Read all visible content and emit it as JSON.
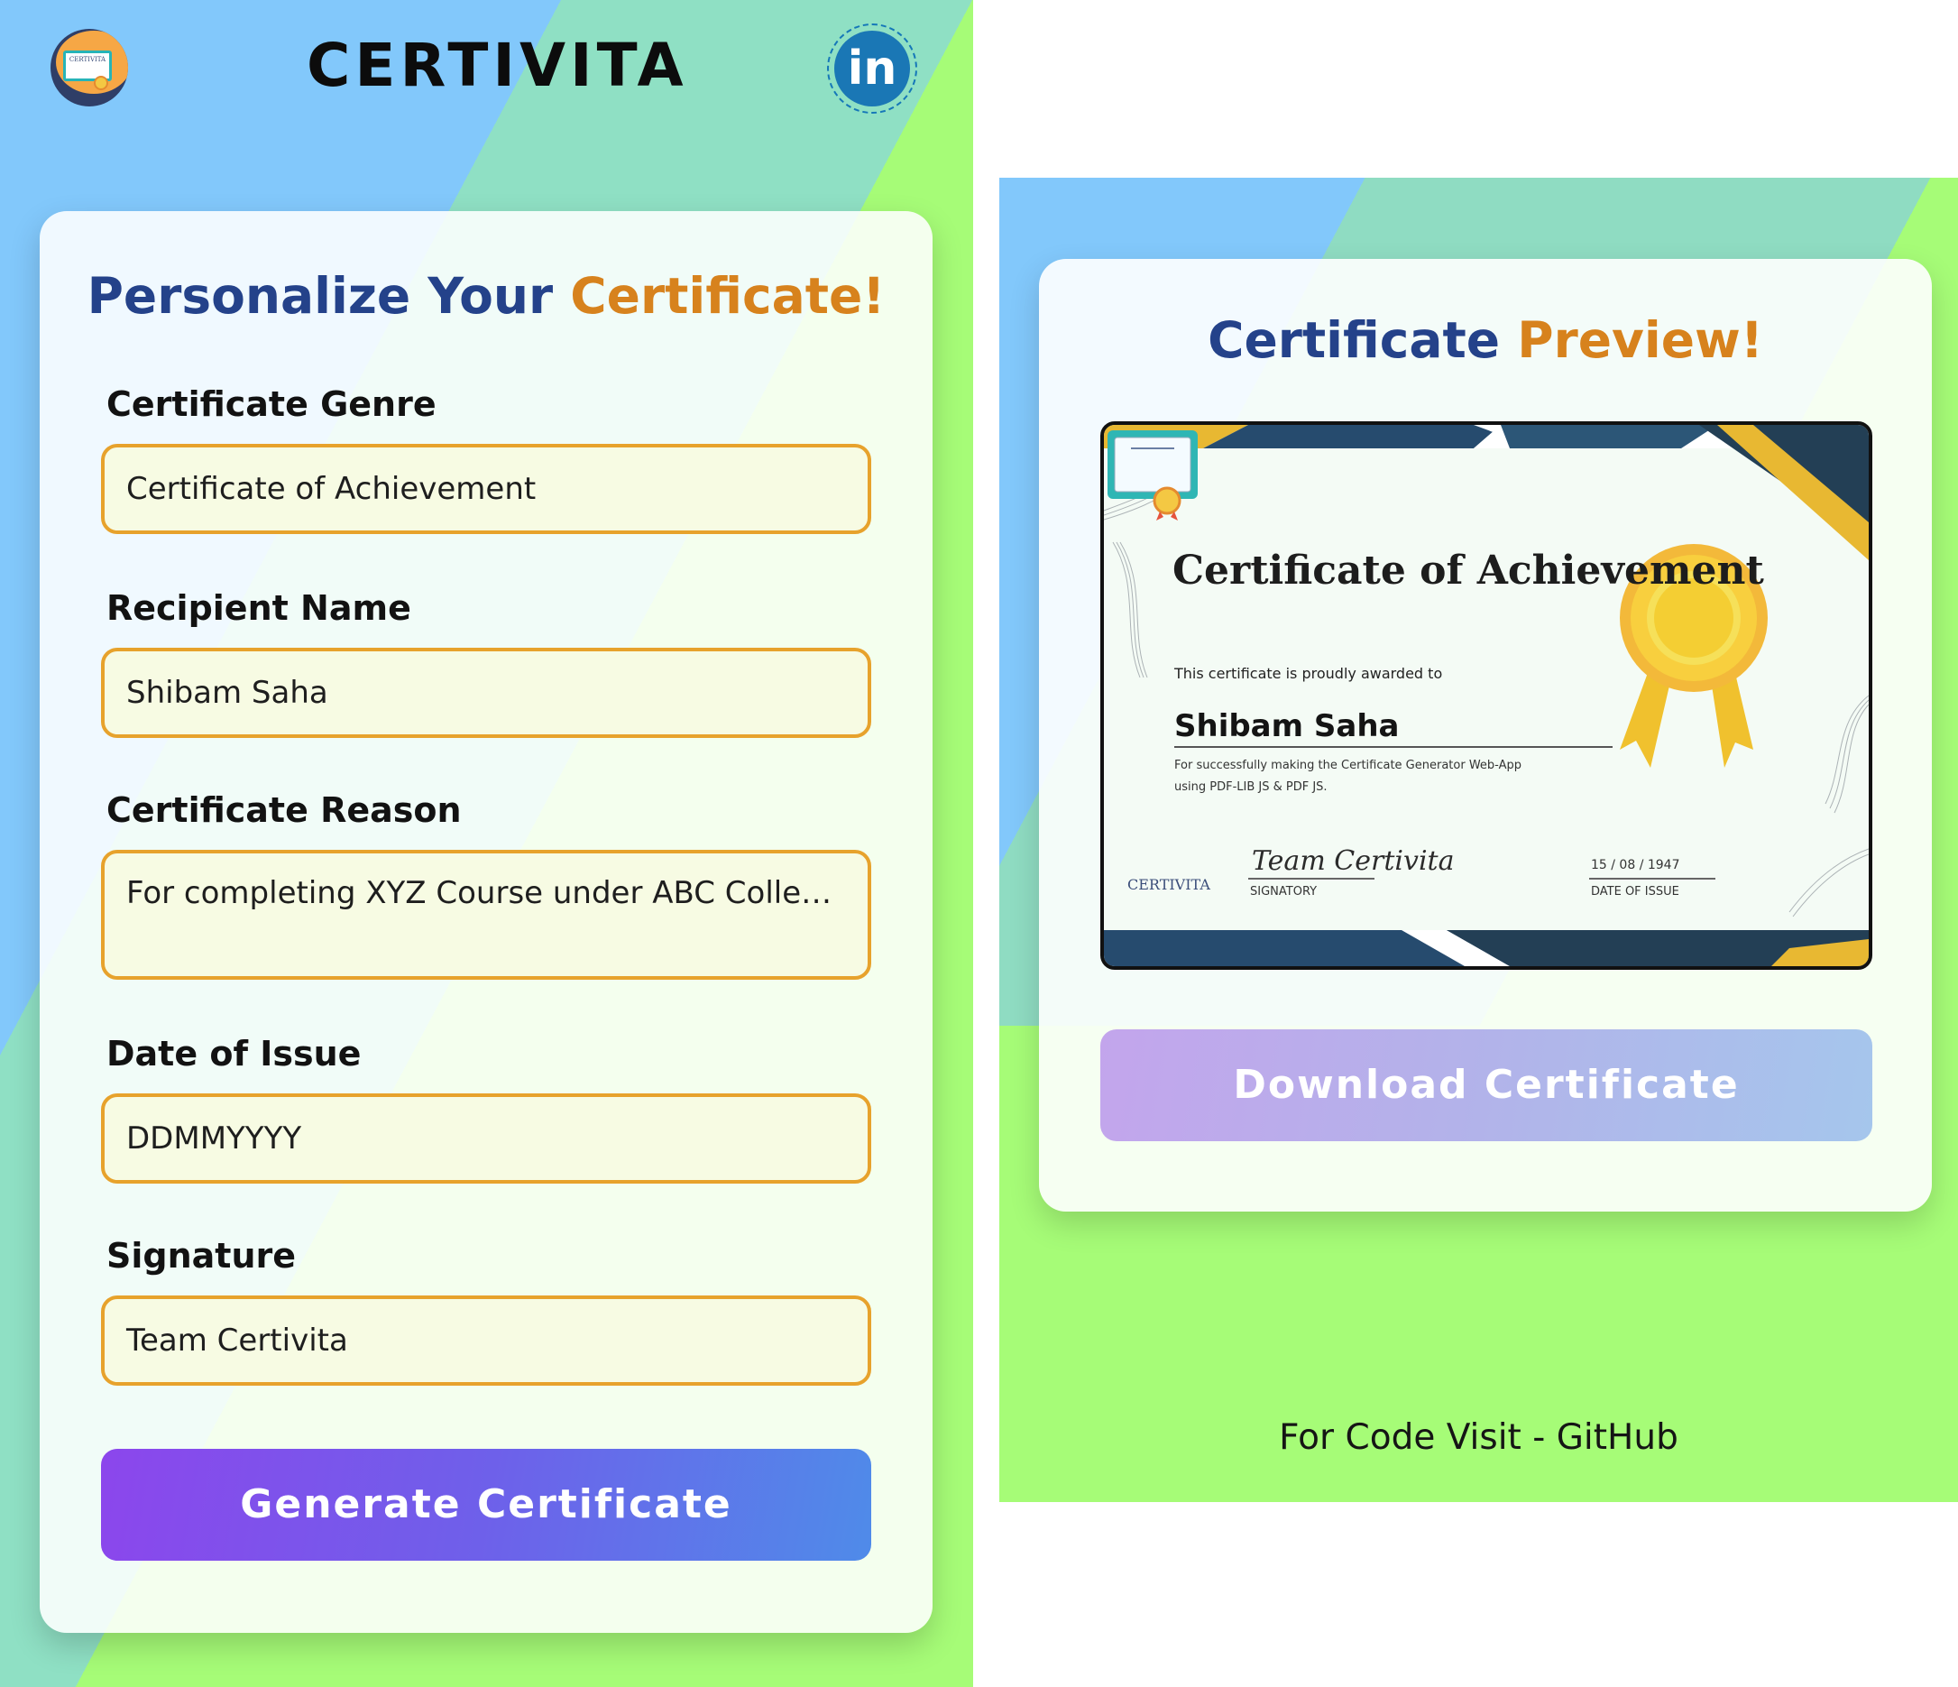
{
  "header": {
    "logo_text": "CERTIVITA",
    "title": "CERTIVITA",
    "linkedin_label": "in"
  },
  "form": {
    "heading_main": "Personalize Your",
    "heading_accent": "Certificate!",
    "fields": [
      {
        "label": "Certificate Genre",
        "value": "Certificate of Achievement"
      },
      {
        "label": "Recipient Name",
        "value": "Shibam Saha"
      },
      {
        "label": "Certificate Reason",
        "value": "For completing XYZ Course under ABC College..."
      },
      {
        "label": "Date of Issue",
        "value": "DDMMYYYY"
      },
      {
        "label": "Signature",
        "value": "Team Certivita"
      }
    ],
    "generate_label": "Generate Certificate"
  },
  "preview": {
    "heading_main": "Certificate",
    "heading_accent": "Preview!",
    "certificate": {
      "title": "Certificate of Achievement",
      "awarded_text": "This certificate is proudly awarded to",
      "recipient": "Shibam Saha",
      "reason_line1": "For successfully making the Certificate Generator Web-App",
      "reason_line2": "using PDF-LIB JS & PDF JS.",
      "signature": "Team Certivita",
      "signature_caption": "SIGNATORY",
      "date": "15 / 08 / 1947",
      "date_caption": "DATE OF ISSUE",
      "badge_text": "CERTIVITA"
    },
    "download_label": "Download Certificate"
  },
  "footer": {
    "prefix": "For Code Visit - ",
    "link_label": "GitHub"
  },
  "colors": {
    "heading_blue": "#24428a",
    "accent_orange": "#d7821d",
    "input_border": "#e7a22c",
    "bg_blue": "#82c8fb",
    "bg_teal": "#8fe0c4",
    "bg_green": "#a6fc77"
  }
}
